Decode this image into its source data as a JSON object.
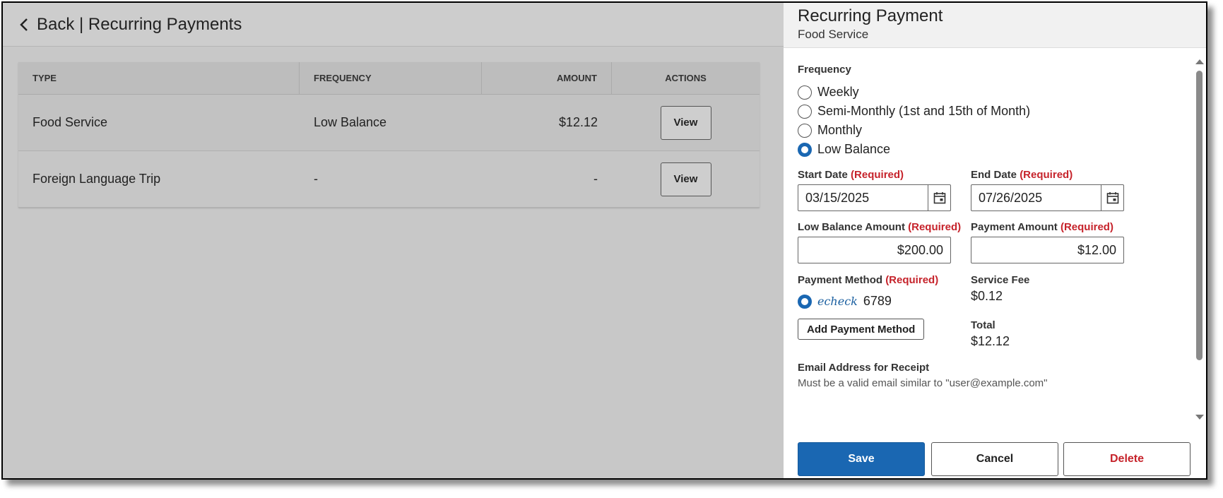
{
  "header": {
    "back_title": "Back | Recurring Payments"
  },
  "table": {
    "columns": [
      "TYPE",
      "FREQUENCY",
      "AMOUNT",
      "ACTIONS"
    ],
    "rows": [
      {
        "type": "Food Service",
        "frequency": "Low Balance",
        "amount": "$12.12",
        "action": "View"
      },
      {
        "type": "Foreign Language Trip",
        "frequency": "-",
        "amount": "-",
        "action": "View"
      }
    ]
  },
  "panel": {
    "title": "Recurring Payment",
    "subtitle": "Food Service",
    "frequency_label": "Frequency",
    "frequency_options": [
      "Weekly",
      "Semi-Monthly (1st and 15th of Month)",
      "Monthly",
      "Low Balance"
    ],
    "frequency_selected": "Low Balance",
    "required_text": "(Required)",
    "start_date_label": "Start Date",
    "start_date": "03/15/2025",
    "end_date_label": "End Date",
    "end_date": "07/26/2025",
    "low_balance_label": "Low Balance Amount",
    "low_balance_amount": "$200.00",
    "payment_amount_label": "Payment Amount",
    "payment_amount": "$12.00",
    "payment_method_label": "Payment Method",
    "payment_method_logo": "echeck",
    "payment_method_account": "6789",
    "add_payment_method": "Add Payment Method",
    "service_fee_label": "Service Fee",
    "service_fee": "$0.12",
    "total_label": "Total",
    "total": "$12.12",
    "email_label": "Email Address for Receipt",
    "email_hint": "Must be a valid email similar to \"user@example.com\""
  },
  "footer": {
    "save": "Save",
    "cancel": "Cancel",
    "delete": "Delete"
  },
  "colors": {
    "primary": "#1a67b2",
    "required": "#c6232b"
  },
  "icons": [
    "chevron-left-icon",
    "calendar-icon",
    "scroll-up-icon",
    "scroll-down-icon"
  ]
}
